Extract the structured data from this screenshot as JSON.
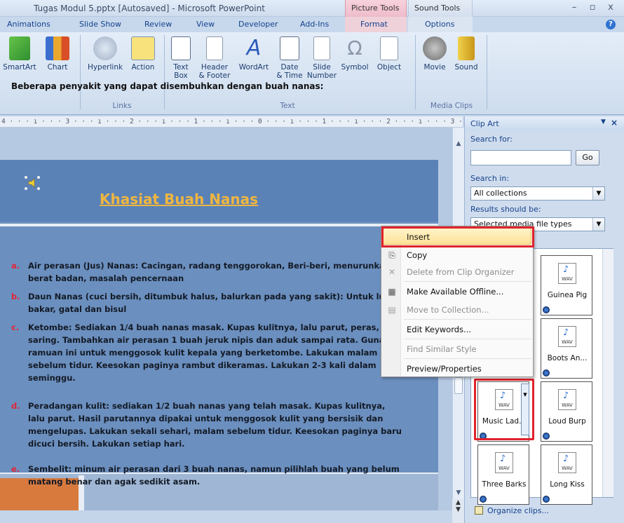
{
  "window": {
    "title": "Tugas Modul 5.pptx [Autosaved] - Microsoft PowerPoint",
    "context_groups": [
      "Picture Tools",
      "Sound Tools"
    ],
    "controls": [
      "–",
      "▫",
      "x"
    ]
  },
  "ribbon_tabs": [
    "Animations",
    "Slide Show",
    "Review",
    "View",
    "Developer",
    "Add-Ins",
    "Format",
    "Options"
  ],
  "ribbon": {
    "buttons": [
      {
        "label": "SmartArt",
        "icon": "smartart-icon"
      },
      {
        "label": "Chart",
        "icon": "chart-icon"
      },
      {
        "label": "Hyperlink",
        "icon": "hyperlink-icon"
      },
      {
        "label": "Action",
        "icon": "action-icon"
      },
      {
        "label": "Text\nBox",
        "icon": "textbox-icon"
      },
      {
        "label": "Header\n& Footer",
        "icon": "header-footer-icon"
      },
      {
        "label": "WordArt",
        "icon": "wordart-icon"
      },
      {
        "label": "Date\n& Time",
        "icon": "date-time-icon"
      },
      {
        "label": "Slide\nNumber",
        "icon": "slide-number-icon"
      },
      {
        "label": "Symbol",
        "icon": "symbol-icon"
      },
      {
        "label": "Object",
        "icon": "object-icon"
      },
      {
        "label": "Movie",
        "icon": "movie-icon"
      },
      {
        "label": "Sound",
        "icon": "sound-icon"
      }
    ],
    "groups": [
      "Links",
      "Text",
      "Media Clips"
    ]
  },
  "ruler": "4 · · · ı · · · 3 · · · ı · · · 2 · · · ı · · · 1 · · · ı · · · 0 · · · ı · · · 1 · · · ı · · · 2 · · · ı · · · 3 · · · ı · · · 4 · · · ı · · · ·",
  "slide": {
    "title": "Khasiat Buah Nanas",
    "intro": "Beberapa penyakit yang dapat disembuhkan dengan buah nanas:",
    "items": [
      {
        "marker": "a.",
        "text": "Air perasan (Jus) Nanas: Cacingan, radang tenggorokan, Beri-beri, menurunkan berat badan, masalah pencernaan"
      },
      {
        "marker": "b.",
        "text": "Daun Nanas (cuci bersih, ditumbuk halus, balurkan pada yang sakit): Untuk luka bakar, gatal dan bisul"
      },
      {
        "marker": "c.",
        "text": "Ketombe: Sediakan 1/4 buah nanas masak. Kupas kulitnya, lalu parut, peras, dan saring. Tambahkan air perasan 1 buah jeruk nipis dan aduk sampai rata. Gunakan ramuan ini untuk menggosok kulit kepala yang berketombe. Lakukan malam sebelum tidur. Keesokan paginya rambut dikeramas. Lakukan 2-3 kali dalam seminggu."
      },
      {
        "marker": "d.",
        "text": "Peradangan kulit: sediakan 1/2 buah nanas yang telah masak. Kupas kulitnya, lalu parut. Hasil parutannya dipakai untuk menggosok kulit yang bersisik dan mengelupas. Lakukan sekali sehari, malam sebelum tidur. Keesokan paginya baru dicuci bersih. Lakukan setiap hari."
      },
      {
        "marker": "e.",
        "text": "Sembelit: minum air perasan dari 3 buah nanas, namun pilihlah buah yang belum matang benar dan agak sedikit asam."
      }
    ]
  },
  "clipart": {
    "title": "Clip Art",
    "search_for_label": "Search for:",
    "search_value": "",
    "go_label": "Go",
    "search_in_label": "Search in:",
    "search_in_value": "All collections",
    "results_label": "Results should be:",
    "results_value": "Selected media file types",
    "thumbnails": [
      {
        "caption": "Guinea Pig"
      },
      {
        "caption": "Boots An..."
      },
      {
        "caption": "Music Lad..."
      },
      {
        "caption": "Loud Burp"
      },
      {
        "caption": "Three Barks"
      },
      {
        "caption": "Long Kiss"
      }
    ],
    "wav_label": "WAV",
    "organize_label": "Organize clips..."
  },
  "context_menu": {
    "items": [
      {
        "label": "Insert",
        "enabled": true,
        "icon": ""
      },
      {
        "label": "Copy",
        "enabled": true,
        "icon": "copy-icon"
      },
      {
        "label": "Delete from Clip Organizer",
        "enabled": false,
        "icon": "delete-icon"
      },
      {
        "label": "Make Available Offline...",
        "enabled": true,
        "icon": "offline-icon"
      },
      {
        "label": "Move to Collection...",
        "enabled": false,
        "icon": "move-icon"
      },
      {
        "label": "Edit Keywords...",
        "enabled": true,
        "icon": ""
      },
      {
        "label": "Find Similar Style",
        "enabled": false,
        "icon": ""
      },
      {
        "label": "Preview/Properties",
        "enabled": true,
        "icon": ""
      }
    ]
  },
  "colors": {
    "slide_bg": "#6b8fbe",
    "title_gold": "#f0b640",
    "marker_red": "#e0273b",
    "highlight_red": "#e0222c",
    "orange_block": "#d87a3e"
  }
}
